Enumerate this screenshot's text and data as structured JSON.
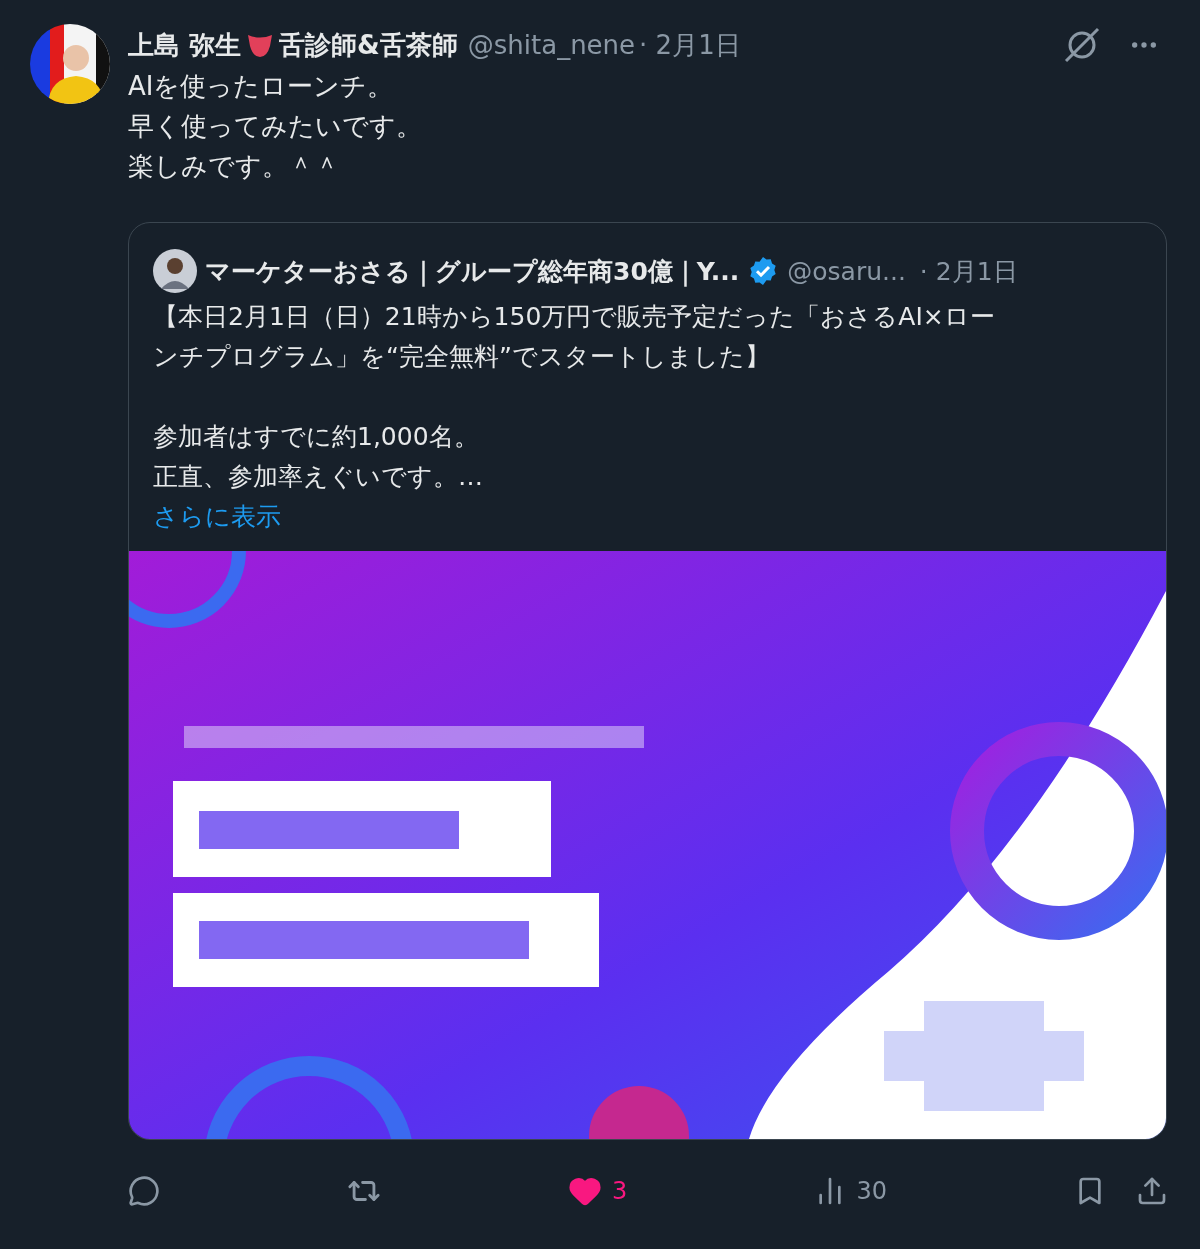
{
  "post": {
    "author": {
      "name": "上島 弥生",
      "name_suffix": "舌診師&舌茶師",
      "handle": "@shita_nene",
      "date": "· 2月1日"
    },
    "lines": [
      "AIを使ったローンチ。",
      "早く使ってみたいです。",
      "楽しみです。＾＾"
    ],
    "quote": {
      "author": {
        "name": "マーケターおさる｜グループ総年商30億｜Y...",
        "verified": true,
        "handle": "@osaru...",
        "date": "· 2月1日"
      },
      "paragraphs": [
        [
          "【本日2月1日（日）21時から150万円で販売予定だった「おさるAI×ロー",
          "ンチプログラム」を“完全無料”でスタートしました】"
        ],
        [
          "参加者はすでに約1,000名。",
          "正直、参加率えぐいです。…"
        ]
      ],
      "show_more": "さらに表示",
      "media": {
        "kind": "picture"
      }
    },
    "actions": {
      "liked": true,
      "like_count": "3",
      "views": "30"
    }
  }
}
